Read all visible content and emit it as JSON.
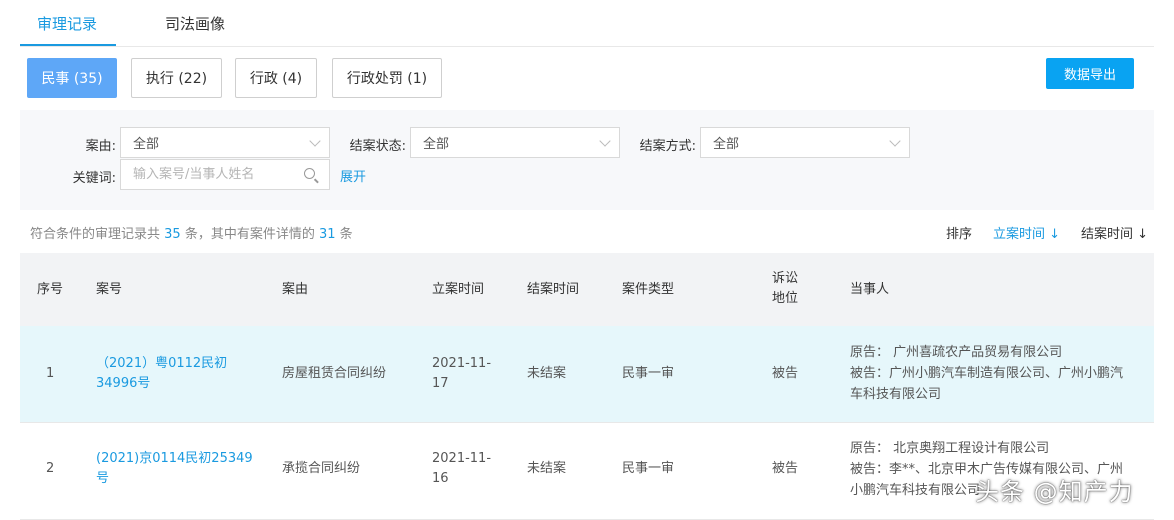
{
  "tabs": [
    {
      "label": "审理记录",
      "active": true
    },
    {
      "label": "司法画像",
      "active": false
    }
  ],
  "filters": [
    {
      "label": "民事 (35)",
      "active": true
    },
    {
      "label": "执行 (22)",
      "active": false
    },
    {
      "label": "行政 (4)",
      "active": false
    },
    {
      "label": "行政处罚 (1)",
      "active": false
    }
  ],
  "export_label": "数据导出",
  "filter_panel": {
    "cause_label": "案由:",
    "cause_value": "全部",
    "status_label": "结案状态:",
    "status_value": "全部",
    "method_label": "结案方式:",
    "method_value": "全部",
    "keyword_label": "关键词:",
    "keyword_placeholder": "输入案号/当事人姓名",
    "expand_label": "展开"
  },
  "summary": {
    "prefix": "符合条件的审理记录共 ",
    "total": "35",
    "middle": " 条，其中有案件详情的 ",
    "detail": "31",
    "suffix": " 条"
  },
  "sort": {
    "label": "排序",
    "items": [
      {
        "label": "立案时间 ↓",
        "active": true
      },
      {
        "label": "结案时间 ↓",
        "active": false
      }
    ]
  },
  "table": {
    "headers": [
      "序号",
      "案号",
      "案由",
      "立案时间",
      "结案时间",
      "案件类型",
      "诉讼地位",
      "当事人"
    ],
    "rows": [
      {
        "index": "1",
        "case_no": "（2021）粤0112民初34996号",
        "cause": "房屋租赁合同纠纷",
        "filed": "2021-11-17",
        "closed": "未结案",
        "type": "民事一审",
        "role": "被告",
        "plaintiff_label": "原告：",
        "plaintiff": "广州喜疏农产品贸易有限公司",
        "defendant_label": "被告：",
        "defendant": "广州小鹏汽车制造有限公司、广州小鹏汽车科技有限公司"
      },
      {
        "index": "2",
        "case_no": "(2021)京0114民初25349号",
        "cause": "承揽合同纠纷",
        "filed": "2021-11-16",
        "closed": "未结案",
        "type": "民事一审",
        "role": "被告",
        "plaintiff_label": "原告：",
        "plaintiff": "北京奥翔工程设计有限公司",
        "defendant_label": "被告：",
        "defendant": "李**、北京甲木广告传媒有限公司、广州小鹏汽车科技有限公司"
      }
    ]
  },
  "watermark": "头条 @知产力",
  "colors": {
    "accent": "#1a9ae0",
    "active_filter": "#5ea7f7",
    "export": "#09a3f2",
    "row_highlight": "#e6f7fb"
  }
}
